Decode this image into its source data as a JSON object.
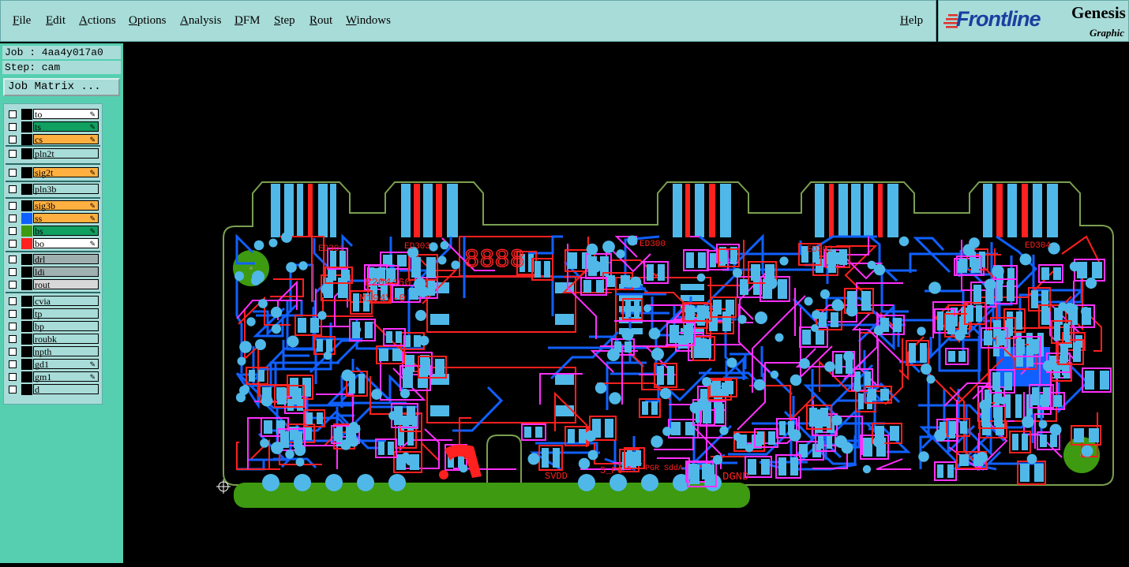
{
  "menu": [
    "File",
    "Edit",
    "Actions",
    "Options",
    "Analysis",
    "DFM",
    "Step",
    "Rout",
    "Windows"
  ],
  "help": "Help",
  "logo": {
    "brand": "Frontline",
    "product": "Genesis",
    "sub": "Graphic"
  },
  "job": "Job : 4aa4y017a0",
  "step": "Step: cam",
  "job_matrix": "Job Matrix ...",
  "layers": [
    {
      "name": "to",
      "color": "#ffffff",
      "edit": true
    },
    {
      "name": "ts",
      "color": "#10a060",
      "edit": true
    },
    {
      "name": "cs",
      "color": "#ffb040",
      "edit": true
    },
    {
      "name": "pln2t",
      "color": "#a8dcd8",
      "edit": false
    },
    {
      "name": "sig2t",
      "color": "#ffb040",
      "edit": true
    },
    {
      "name": "pln3b",
      "color": "#a8dcd8",
      "edit": false
    },
    {
      "name": "sig3b",
      "color": "#ffb040",
      "edit": true
    },
    {
      "name": "ss",
      "color": "#ffb040",
      "edit": true
    },
    {
      "name": "bs",
      "color": "#10a060",
      "edit": true
    },
    {
      "name": "bo",
      "color": "#ffffff",
      "edit": true
    },
    {
      "name": "drl",
      "color": "#a0b0b0",
      "edit": false
    },
    {
      "name": "ldi",
      "color": "#a0b0b0",
      "edit": false
    },
    {
      "name": "rout",
      "color": "#d8d8d8",
      "edit": false
    },
    {
      "name": "cvia",
      "color": "#a8dcd8",
      "edit": false
    },
    {
      "name": "tp",
      "color": "#a8dcd8",
      "edit": false
    },
    {
      "name": "bp",
      "color": "#a8dcd8",
      "edit": false
    },
    {
      "name": "roubk",
      "color": "#a8dcd8",
      "edit": false
    },
    {
      "name": "npth",
      "color": "#a8dcd8",
      "edit": false
    },
    {
      "name": "gd1",
      "color": "#a8dcd8",
      "edit": true
    },
    {
      "name": "gm1",
      "color": "#a8dcd8",
      "edit": true
    },
    {
      "name": "d",
      "color": "#a8dcd8",
      "edit": false
    }
  ],
  "board": {
    "connector_labels": [
      "ED301",
      "ED303",
      "ED300",
      "ED302",
      "ED304"
    ],
    "part_numbers": [
      "E204460",
      "M194V-0"
    ],
    "display_digits": "8888",
    "bottom_labels": [
      "SVDD",
      "5_P6",
      "PGR SddA",
      "DGND"
    ]
  }
}
